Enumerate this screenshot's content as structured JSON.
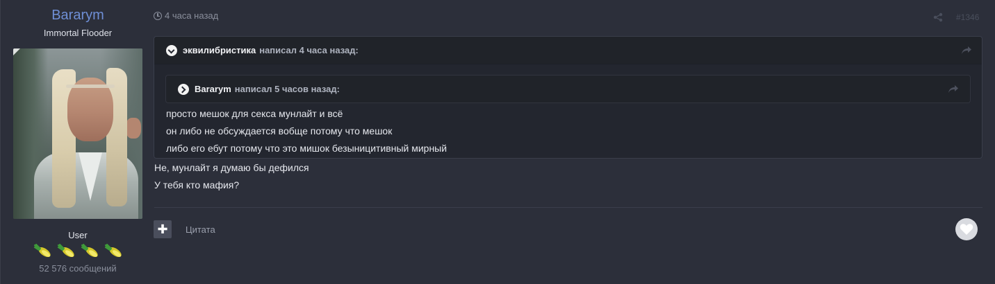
{
  "author": {
    "username": "Bararym",
    "title": "Immortal Flooder",
    "role": "User",
    "message_count": "52 576 сообщений",
    "badges": [
      "badge-icon",
      "badge-icon",
      "badge-icon",
      "badge-icon"
    ]
  },
  "post": {
    "time": "4 часа назад",
    "post_number": "#1346",
    "quote": {
      "author": "эквилибристика",
      "wrote": "написал 4 часа назад:",
      "inner_quote": {
        "author": "Bararym",
        "wrote": "написал 5 часов назад:"
      },
      "lines": [
        "просто мешок для секса мунлайт и всё",
        "он либо не обсуждается вобще потому что мешок",
        "либо его ебут потому что это мишок безыницитивный мирный"
      ]
    },
    "body": [
      "Не, мунлайт я думаю бы дефился",
      "У тебя кто мафия?"
    ]
  },
  "actions": {
    "plus": "✚",
    "quote_label": "Цитата"
  },
  "colors": {
    "background": "#2c2f3a",
    "username": "#6f8fd6",
    "quote_bg": "#23262f"
  }
}
